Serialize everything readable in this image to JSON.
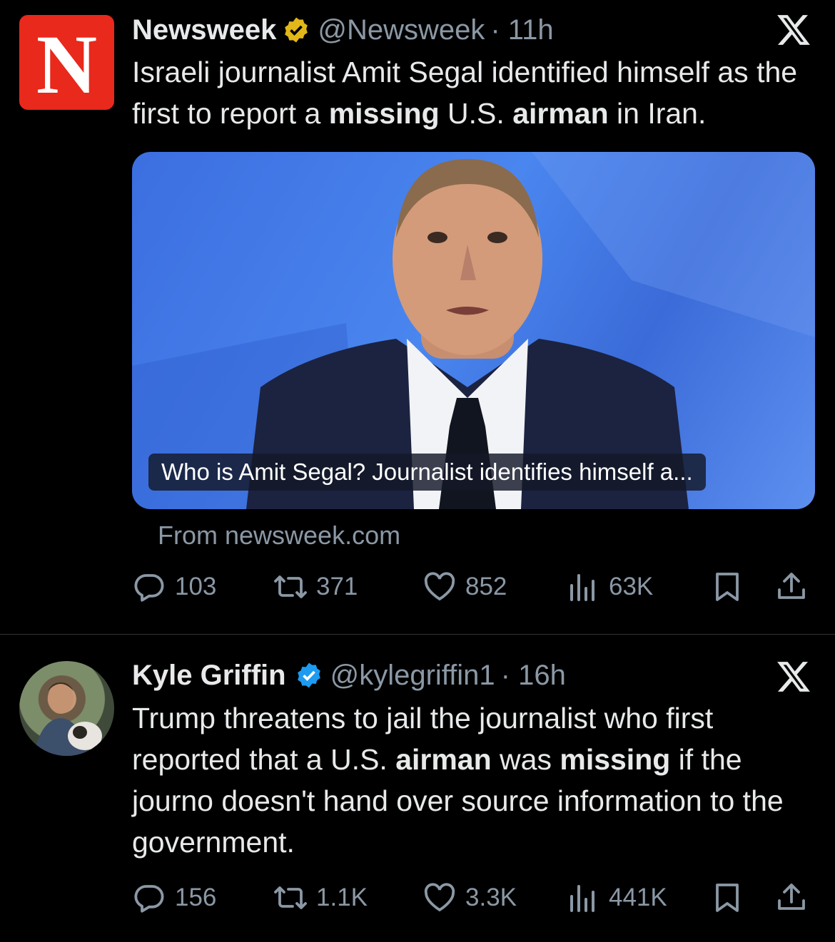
{
  "tweets": [
    {
      "author": "Newsweek",
      "handle": "@Newsweek",
      "time": "· 11h",
      "avatar_letter": "N",
      "badge_color": "#e2b719",
      "text_parts": [
        {
          "t": "Israeli journalist Amit Segal identified himself as the first to report a ",
          "b": false
        },
        {
          "t": "missing",
          "b": true
        },
        {
          "t": " U.S. ",
          "b": false
        },
        {
          "t": "airman",
          "b": true
        },
        {
          "t": " in Iran.",
          "b": false
        }
      ],
      "card_caption": "Who is Amit Segal? Journalist identifies himself a...",
      "card_source": "From newsweek.com",
      "stats": {
        "replies": "103",
        "reposts": "371",
        "likes": "852",
        "views": "63K"
      }
    },
    {
      "author": "Kyle Griffin",
      "handle": "@kylegriffin1",
      "time": "· 16h",
      "badge_color": "#1d9bf0",
      "text_parts": [
        {
          "t": "Trump threatens to jail the journalist who first reported that a U.S. ",
          "b": false
        },
        {
          "t": "airman",
          "b": true
        },
        {
          "t": " was ",
          "b": false
        },
        {
          "t": "missing",
          "b": true
        },
        {
          "t": " if the journo doesn't hand over source information to the government.",
          "b": false
        }
      ],
      "stats": {
        "replies": "156",
        "reposts": "1.1K",
        "likes": "3.3K",
        "views": "441K"
      }
    }
  ],
  "icons": {
    "reply": "speech-bubble-icon",
    "repost": "repost-arrows-icon",
    "like": "heart-icon",
    "views": "bar-chart-icon",
    "bookmark": "bookmark-icon",
    "share": "share-upload-icon",
    "platform": "x-logo-icon"
  }
}
